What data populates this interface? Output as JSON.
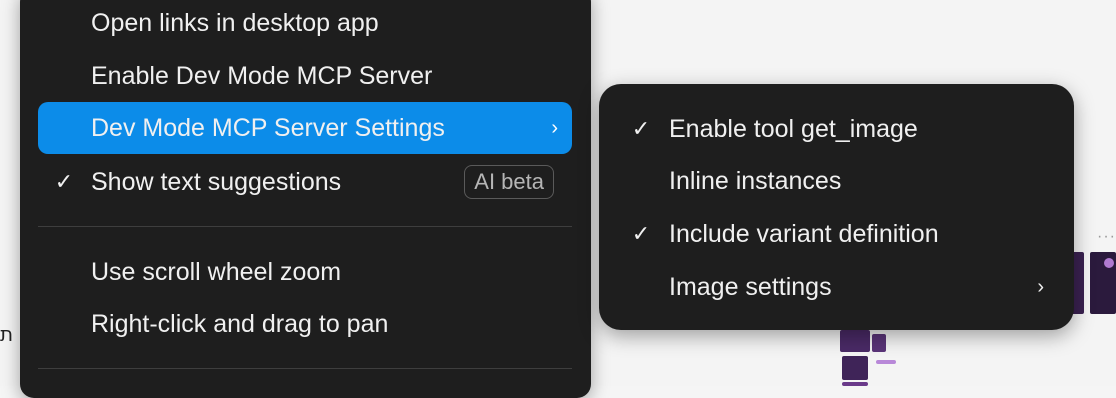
{
  "background": {
    "glyph": "ת",
    "more_dots": "···"
  },
  "main_menu": {
    "items": [
      {
        "label": "Open links in desktop app",
        "checked": false
      },
      {
        "label": "Enable Dev Mode MCP Server",
        "checked": false
      },
      {
        "label": "Dev Mode MCP Server Settings",
        "checked": false,
        "highlighted": true,
        "submenu": true
      },
      {
        "label": "Show text suggestions",
        "checked": true,
        "badge": "AI beta"
      },
      {
        "label": "Use scroll wheel zoom",
        "checked": false
      },
      {
        "label": "Right-click and drag to pan",
        "checked": false
      }
    ],
    "check_glyph": "✓",
    "chevron_glyph": "›"
  },
  "sub_menu": {
    "items": [
      {
        "label": "Enable tool get_image",
        "checked": true
      },
      {
        "label": "Inline instances",
        "checked": false
      },
      {
        "label": "Include variant definition",
        "checked": true
      },
      {
        "label": "Image settings",
        "checked": false,
        "submenu": true
      }
    ]
  },
  "colors": {
    "menu_bg": "#1e1e1e",
    "highlight": "#0c8ce9",
    "text": "#f0f0f0",
    "badge_text": "#b5b5b5"
  },
  "icons": {
    "check": "check-icon",
    "chevron": "chevron-right-icon"
  }
}
